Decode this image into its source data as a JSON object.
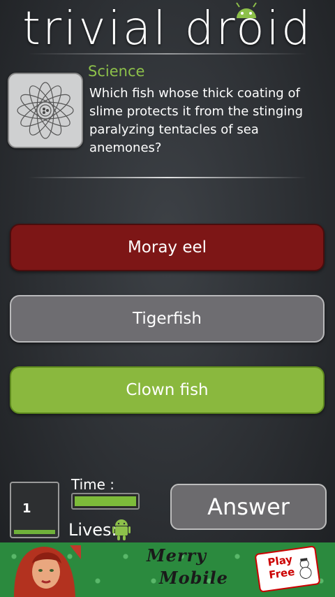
{
  "app": {
    "title": "trivial droid"
  },
  "question": {
    "category": "Science",
    "category_icon": "atom-icon",
    "text": "Which fish whose thick coating of slime protects it from the stinging paralyzing tentacles of sea anemones?"
  },
  "answers": [
    {
      "label": "Moray eel",
      "state": "wrong",
      "color": "#7d1616"
    },
    {
      "label": "Tigerfish",
      "state": "neutral",
      "color": "#6e6d71"
    },
    {
      "label": "Clown fish",
      "state": "correct",
      "color": "#8ab83e"
    }
  ],
  "status": {
    "score": "1",
    "time_label": "Time :",
    "time_remaining_fraction": 1.0,
    "lives_label": "Lives:",
    "lives_count": 1,
    "lives_icon": "android-icon"
  },
  "submit": {
    "label": "Answer"
  },
  "ad": {
    "line1": "Merry",
    "line2": "Mobile",
    "cta": "Play Free"
  },
  "colors": {
    "accent_green": "#8dc04a",
    "wrong_red": "#7d1616"
  }
}
